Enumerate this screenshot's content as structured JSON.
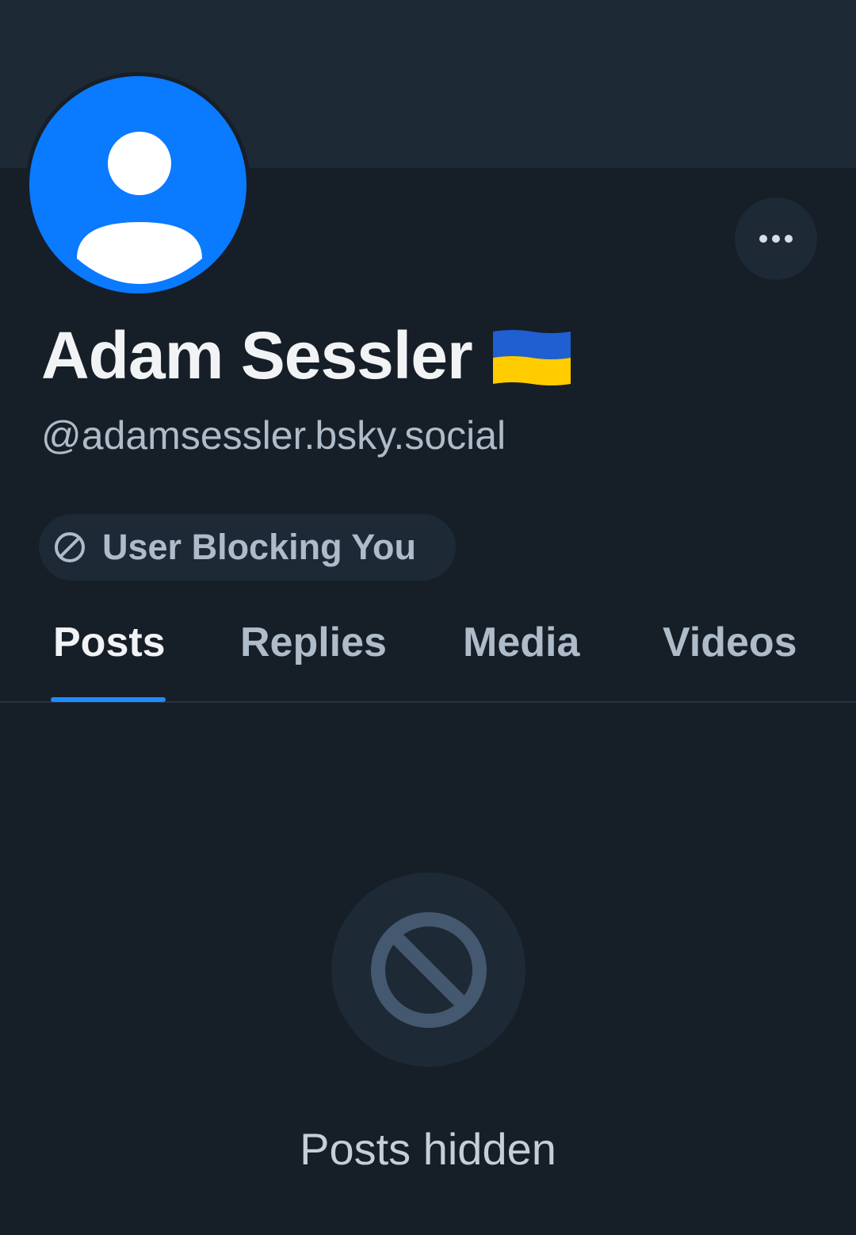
{
  "profile": {
    "display_name": "Adam Sessler",
    "flag_icon": "ukraine-flag-icon",
    "handle": "@adamsessler.bsky.social",
    "avatar_icon": "default-avatar-icon"
  },
  "actions": {
    "more_icon": "ellipsis-icon"
  },
  "block_status": {
    "icon": "block-icon",
    "label": "User Blocking You"
  },
  "tabs": [
    {
      "label": "Posts",
      "active": true
    },
    {
      "label": "Replies",
      "active": false
    },
    {
      "label": "Media",
      "active": false
    },
    {
      "label": "Videos",
      "active": false
    }
  ],
  "empty_state": {
    "icon": "block-icon",
    "message": "Posts hidden"
  },
  "colors": {
    "background": "#161e27",
    "banner": "#1e2936",
    "accent": "#208bfe",
    "avatar_blue": "#0a7aff",
    "muted_text": "#aebbc9",
    "primary_text": "#f1f3f5"
  }
}
